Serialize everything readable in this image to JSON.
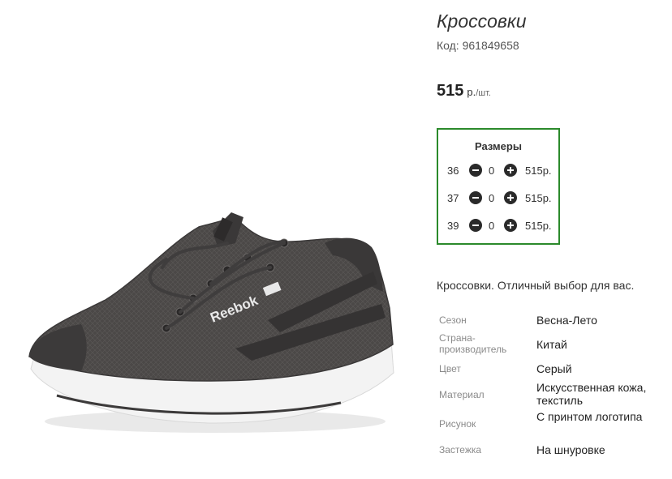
{
  "product": {
    "title": "Кроссовки",
    "code": "Код: 961849658",
    "price_value": "515",
    "price_currency": "р.",
    "price_unit": "/шт.",
    "logo_text": "Reebok"
  },
  "sizes": {
    "title": "Размеры",
    "rows": [
      {
        "size": "36",
        "qty": "0",
        "price": "515р."
      },
      {
        "size": "37",
        "qty": "0",
        "price": "515р."
      },
      {
        "size": "39",
        "qty": "0",
        "price": "515р."
      }
    ]
  },
  "description": "Кроссовки. Отличный выбор для вас.",
  "properties": [
    {
      "name": "Сезон",
      "value": "Весна-Лето"
    },
    {
      "name": "Страна-производитель",
      "value": "Китай"
    },
    {
      "name": "Цвет",
      "value": "Серый"
    },
    {
      "name": "Материал",
      "value": "Искусственная кожа, текстиль"
    },
    {
      "name": "Рисунок",
      "value": "С принтом логотипа"
    },
    {
      "name": "Застежка",
      "value": "На шнуровке"
    }
  ],
  "colors": {
    "accent_border": "#2b8a2b",
    "button": "#2a2a2a",
    "shoe_body": "#4a4746",
    "sole": "#f2f2f2"
  }
}
